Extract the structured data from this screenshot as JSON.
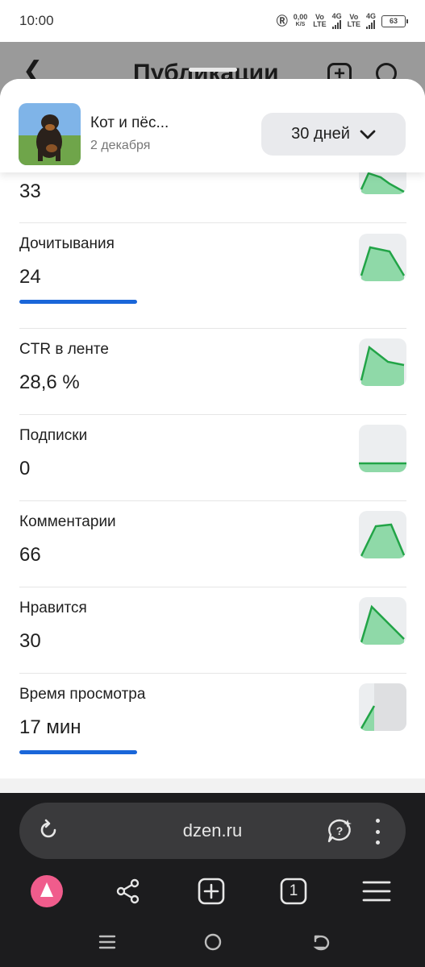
{
  "status_bar": {
    "time": "10:00",
    "speed_value": "0,00",
    "speed_unit": "K/S",
    "net1_top": "Vo",
    "net1_bottom": "LTE",
    "net1_gen": "4G",
    "net2_top": "Vo",
    "net2_bottom": "LTE",
    "net2_gen": "4G",
    "battery": "63"
  },
  "background_screen": {
    "title": "Публикации"
  },
  "publication": {
    "title": "Кот и пёс...",
    "date": "2 декабря",
    "period": "30 дней"
  },
  "metrics": [
    {
      "label": "",
      "value": "33",
      "spark": "peak-left-drop"
    },
    {
      "label": "Дочитывания",
      "value": "24",
      "progress": true,
      "spark": "peak-mid-drop"
    },
    {
      "label": "CTR в ленте",
      "value": "28,6 %",
      "spark": "peak-then-flat"
    },
    {
      "label": "Подписки",
      "value": "0",
      "spark": "flat"
    },
    {
      "label": "Комментарии",
      "value": "66",
      "spark": "plateau"
    },
    {
      "label": "Нравится",
      "value": "30",
      "spark": "peak-decline"
    },
    {
      "label": "Время просмотра",
      "value": "17 мин",
      "progress": true,
      "spark": "partial-rise"
    }
  ],
  "browser": {
    "url": "dzen.ru",
    "tabs_count": "1"
  },
  "colors": {
    "accent_progress": "#1a66d9",
    "spark_line": "#22a447",
    "spark_fill": "#8fd9a8",
    "alice": "#f05c8c"
  }
}
